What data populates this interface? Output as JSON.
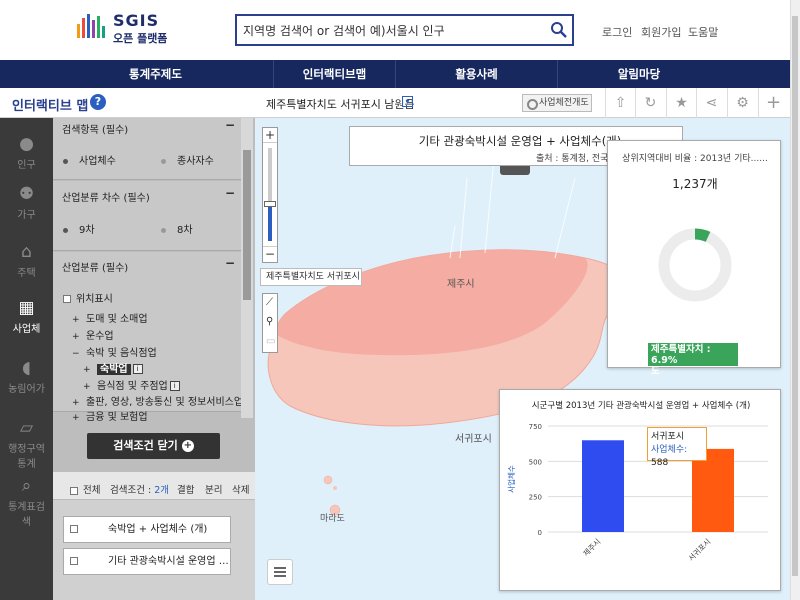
{
  "header": {
    "logo_title": "SGIS",
    "logo_subtitle": "오픈 플랫폼",
    "search_value": "지역명 검색어 or 검색어 예)서울시 인구",
    "links": [
      "로그인",
      "회원가입",
      "도움말"
    ]
  },
  "nav": [
    "통계주제도",
    "인터랙티브맵",
    "활용사례",
    "알림마당"
  ],
  "toolbar": {
    "app_name": "인터랙티브 맵",
    "help": "?",
    "region": "제주특별자치도 서귀포시 남원읍",
    "business_map": "사업체전개도"
  },
  "left_nav": [
    "인구",
    "가구",
    "주택",
    "사업체",
    "농림어가",
    "행정구역통계",
    "통계표검색"
  ],
  "panel": {
    "sect1_title": "검색항목 (필수)",
    "sect1_opt1": "사업체수",
    "sect1_opt2": "종사자수",
    "sect2_title": "산업분류 차수 (필수)",
    "sect2_opt1": "9차",
    "sect2_opt2": "8차",
    "sect3_title": "산업분류 (필수)",
    "tree_root": "위치표시",
    "tree": [
      {
        "label": "도매 및 소매업",
        "mark": "+"
      },
      {
        "label": "운수업",
        "mark": "+"
      },
      {
        "label": "숙박 및 음식점업",
        "mark": "−"
      },
      {
        "label": "숙박업",
        "mark": "+"
      },
      {
        "label": "음식점 및 주점업",
        "mark": "+"
      },
      {
        "label": "출판, 영상, 방송통신 및 정보서비스업",
        "mark": "+"
      },
      {
        "label": "금융 및 보험업",
        "mark": "+"
      }
    ],
    "info": "i",
    "close_btn": "검색조건 닫기",
    "lower": {
      "all": "전체",
      "cond_label": "검색조건 :",
      "cond_count": "2개",
      "merge": "결합",
      "split": "분리",
      "delete": "삭제",
      "cards": [
        "숙박업 + 사업체수 (개)",
        "기타 관광숙박시설 운영업 …"
      ]
    }
  },
  "map": {
    "region_label": "제주특별자치도 서귀포시",
    "title": "기타 관광숙박시설 운영업 + 사업체수(개)",
    "source": "출처 : 통계청, 전국사…",
    "places": [
      "제주시",
      "서귀포시",
      "마라도"
    ],
    "zoom_in": "+",
    "zoom_out": "−"
  },
  "pie": {
    "header": "상위지역대비 비율 : 2013년 기타......",
    "value": "1,237개",
    "label_line1": "제주특별자치 : 6.9%",
    "label_line2": "도",
    "percent": 6.9,
    "colors": {
      "share": "#3aa55a",
      "rest": "#ececec"
    }
  },
  "chart_data": {
    "type": "bar",
    "title": "시군구별 2013년 기타 관광숙박시설 운영업 + 사업체수 (개)",
    "ylabel": "사업체수",
    "categories": [
      "제주시",
      "서귀포시"
    ],
    "values": [
      649,
      588
    ],
    "colors": [
      "#2f4cf0",
      "#ff5a10"
    ],
    "ylim": [
      0,
      750
    ],
    "yticks": [
      0,
      250,
      500,
      750
    ],
    "tooltip": {
      "name": "서귀포시",
      "key": "사업체수:",
      "value": "588"
    }
  }
}
